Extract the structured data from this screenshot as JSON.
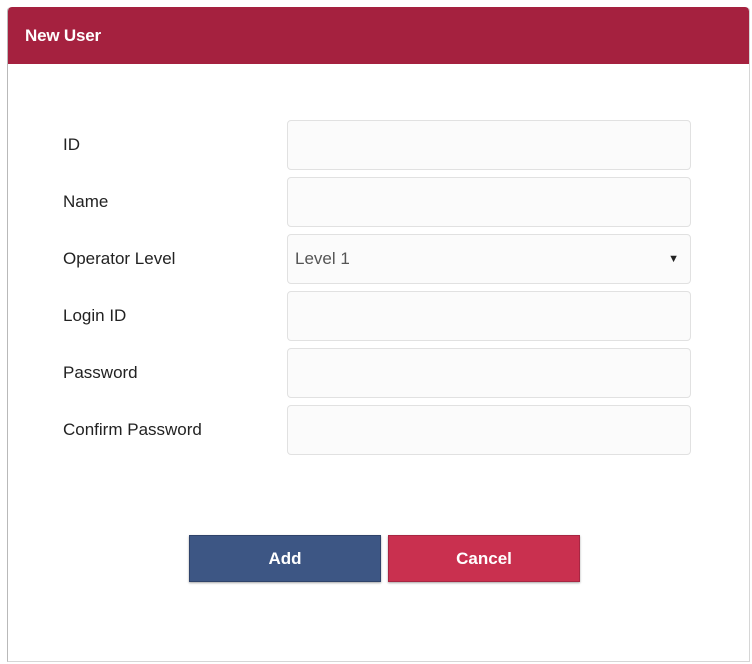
{
  "dialog": {
    "title": "New User"
  },
  "form": {
    "id_label": "ID",
    "id_value": "",
    "name_label": "Name",
    "name_value": "",
    "operator_level_label": "Operator Level",
    "operator_level_value": "Level 1",
    "login_id_label": "Login ID",
    "login_id_value": "",
    "password_label": "Password",
    "password_value": "",
    "confirm_password_label": "Confirm Password",
    "confirm_password_value": ""
  },
  "buttons": {
    "add_label": "Add",
    "cancel_label": "Cancel"
  },
  "icons": {
    "select_caret": "caret-down-icon"
  },
  "colors": {
    "title_bar": "#a5213f",
    "add_button": "#3d5684",
    "cancel_button": "#c9304f"
  }
}
